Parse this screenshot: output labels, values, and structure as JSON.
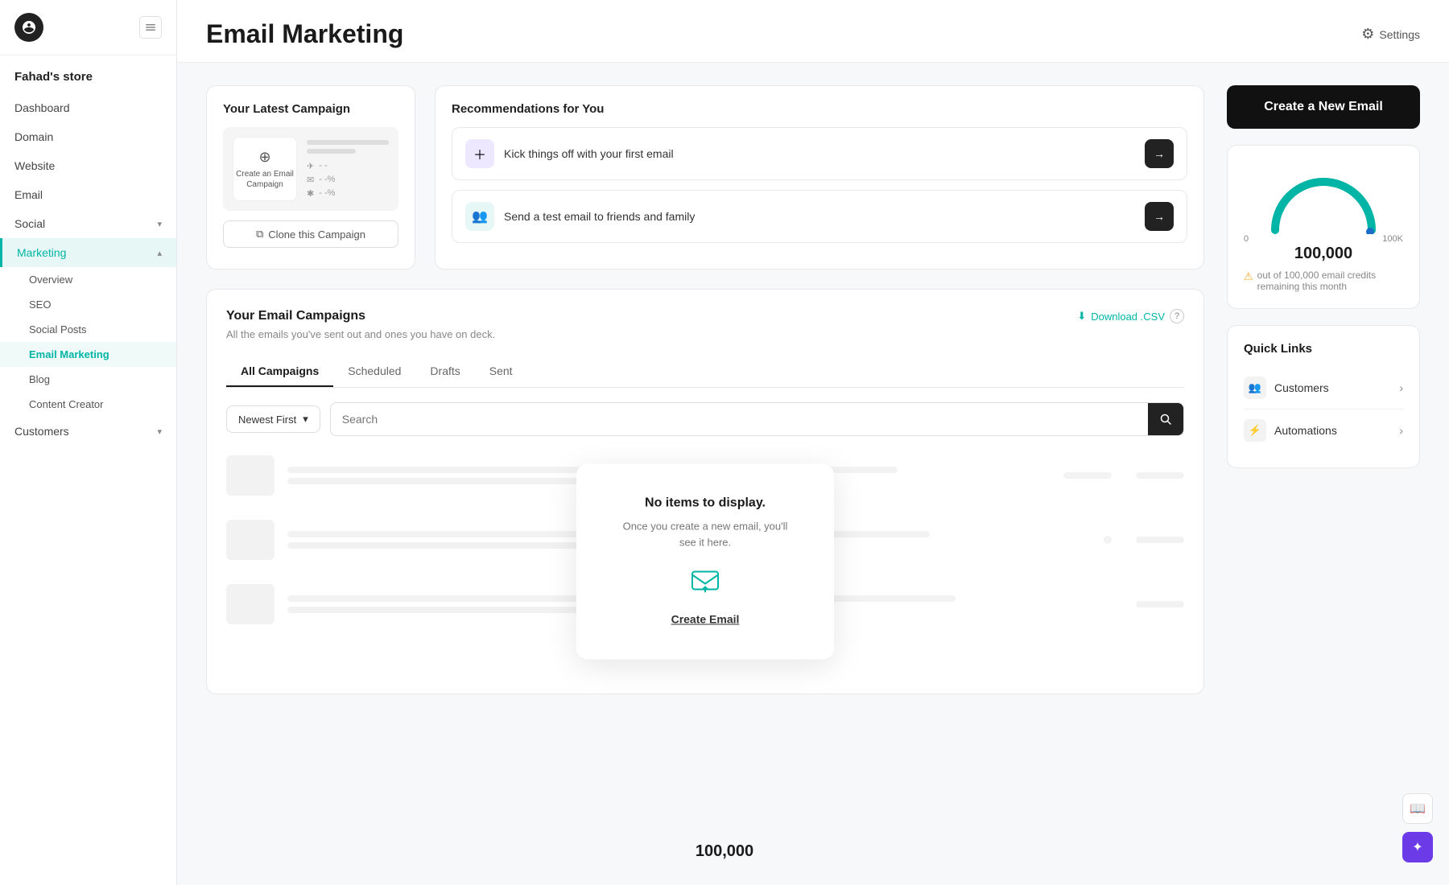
{
  "sidebar": {
    "logo_text": "G",
    "store_name": "Fahad's store",
    "nav_items": [
      {
        "id": "dashboard",
        "label": "Dashboard",
        "has_sub": false,
        "active": false
      },
      {
        "id": "domain",
        "label": "Domain",
        "has_sub": false,
        "active": false
      },
      {
        "id": "website",
        "label": "Website",
        "has_sub": false,
        "active": false
      },
      {
        "id": "email",
        "label": "Email",
        "has_sub": false,
        "active": false
      },
      {
        "id": "social",
        "label": "Social",
        "has_sub": true,
        "active": false
      },
      {
        "id": "marketing",
        "label": "Marketing",
        "has_sub": true,
        "active": true
      }
    ],
    "marketing_sub": [
      {
        "id": "overview",
        "label": "Overview",
        "active": false
      },
      {
        "id": "seo",
        "label": "SEO",
        "active": false
      },
      {
        "id": "social-posts",
        "label": "Social Posts",
        "active": false
      },
      {
        "id": "email-marketing",
        "label": "Email Marketing",
        "active": true
      },
      {
        "id": "blog",
        "label": "Blog",
        "active": false
      },
      {
        "id": "content-creator",
        "label": "Content Creator",
        "active": false
      }
    ],
    "customers": {
      "label": "Customers",
      "has_sub": true,
      "active": false
    }
  },
  "header": {
    "title": "Email Marketing",
    "settings_label": "Settings"
  },
  "campaign_card": {
    "title": "Your Latest Campaign",
    "create_label": "Create an Email Campaign",
    "stats": [
      "- -",
      "- -%",
      "- -%"
    ],
    "clone_btn": "Clone this Campaign"
  },
  "recommendations": {
    "title": "Recommendations for You",
    "items": [
      {
        "id": "first-email",
        "text": "Kick things off with your first email"
      },
      {
        "id": "test-email",
        "text": "Send a test email to friends and family"
      }
    ]
  },
  "campaigns_section": {
    "title": "Your Email Campaigns",
    "subtitle": "All the emails you've sent out and ones you have on deck.",
    "download_csv": "Download .CSV",
    "tabs": [
      {
        "id": "all",
        "label": "All Campaigns",
        "active": true
      },
      {
        "id": "scheduled",
        "label": "Scheduled",
        "active": false
      },
      {
        "id": "drafts",
        "label": "Drafts",
        "active": false
      },
      {
        "id": "sent",
        "label": "Sent",
        "active": false
      }
    ],
    "sort_label": "Newest First",
    "search_placeholder": "Search",
    "empty": {
      "title": "No items to display.",
      "description": "Once you create a new email, you'll see it here.",
      "create_link": "Create Email"
    }
  },
  "credits": {
    "value": "100,000",
    "min": "0",
    "max": "100K",
    "warning": "out of 100,000 email credits remaining this month"
  },
  "create_btn": "Create a New Email",
  "quick_links": {
    "title": "Quick Links",
    "items": [
      {
        "id": "customers",
        "label": "Customers",
        "icon": "👥"
      },
      {
        "id": "automations",
        "label": "Automations",
        "icon": "⚡"
      }
    ]
  },
  "colors": {
    "accent": "#00b5a5",
    "dark": "#111111",
    "border": "#e8e8e8"
  }
}
